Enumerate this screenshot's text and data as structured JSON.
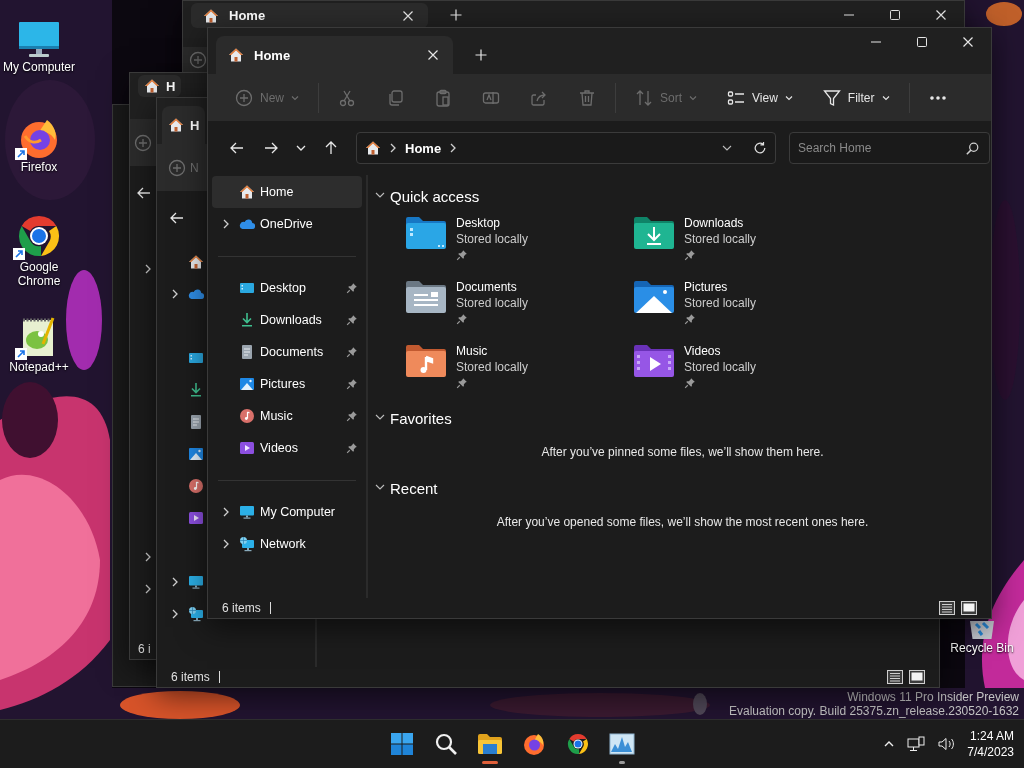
{
  "desktop": {
    "icons": [
      {
        "kind": "computer",
        "label": "My Computer",
        "shortcut": false
      },
      {
        "kind": "firefox",
        "label": "Firefox",
        "shortcut": true
      },
      {
        "kind": "chrome",
        "label": "Google Chrome",
        "shortcut": true
      },
      {
        "kind": "notepad",
        "label": "Notepad++",
        "shortcut": true
      }
    ],
    "recycle_bin": {
      "label": "Recycle Bin"
    }
  },
  "background_windows": [
    {
      "tab_title": "Home"
    },
    {
      "tab_title": "H",
      "status": "6 i"
    },
    {
      "tab_title": "H",
      "new_label": "N",
      "status": "6 items"
    }
  ],
  "window": {
    "tabs": [
      {
        "title": "Home",
        "selected": true
      }
    ],
    "toolbar": [
      {
        "kind": "new",
        "label": "New",
        "disabled": true,
        "menu": true
      },
      {
        "kind": "separator"
      },
      {
        "kind": "cut",
        "disabled": true
      },
      {
        "kind": "copy",
        "disabled": true
      },
      {
        "kind": "paste",
        "disabled": true
      },
      {
        "kind": "rename",
        "disabled": true
      },
      {
        "kind": "share",
        "disabled": true
      },
      {
        "kind": "delete",
        "disabled": true
      },
      {
        "kind": "separator"
      },
      {
        "kind": "sort",
        "label": "Sort",
        "disabled": true,
        "menu": true
      },
      {
        "kind": "view",
        "label": "View",
        "disabled": false,
        "menu": true
      },
      {
        "kind": "filter",
        "label": "Filter",
        "disabled": false,
        "menu": true
      },
      {
        "kind": "separator"
      },
      {
        "kind": "more",
        "disabled": false
      }
    ],
    "address": {
      "segments": [
        "Home"
      ]
    },
    "search": {
      "placeholder": "Search Home"
    },
    "sidebar": {
      "groups": [
        [
          {
            "kind": "home",
            "label": "Home",
            "selected": true
          },
          {
            "kind": "cloud",
            "label": "OneDrive",
            "selected": false,
            "expanded": false
          }
        ],
        [
          {
            "kind": "desktop",
            "label": "Desktop",
            "selected": false,
            "pinned": true
          },
          {
            "kind": "downloads",
            "label": "Downloads",
            "selected": false,
            "pinned": true
          },
          {
            "kind": "documents",
            "label": "Documents",
            "selected": false,
            "pinned": true
          },
          {
            "kind": "pictures",
            "label": "Pictures",
            "selected": false,
            "pinned": true
          },
          {
            "kind": "music",
            "label": "Music",
            "selected": false,
            "pinned": true
          },
          {
            "kind": "videos",
            "label": "Videos",
            "selected": false,
            "pinned": true
          }
        ],
        [
          {
            "kind": "computer",
            "label": "My Computer",
            "selected": false,
            "expanded": false
          },
          {
            "kind": "network",
            "label": "Network",
            "selected": false,
            "expanded": false
          }
        ]
      ]
    },
    "sections": [
      {
        "title": "Quick access",
        "expanded": true,
        "items": [
          {
            "kind": "desktop",
            "name": "Desktop",
            "detail": "Stored locally",
            "pinned": true
          },
          {
            "kind": "downloads",
            "name": "Downloads",
            "detail": "Stored locally",
            "pinned": true
          },
          {
            "kind": "documents",
            "name": "Documents",
            "detail": "Stored locally",
            "pinned": true
          },
          {
            "kind": "pictures",
            "name": "Pictures",
            "detail": "Stored locally",
            "pinned": true
          },
          {
            "kind": "music",
            "name": "Music",
            "detail": "Stored locally",
            "pinned": true
          },
          {
            "kind": "videos",
            "name": "Videos",
            "detail": "Stored locally",
            "pinned": true
          }
        ]
      },
      {
        "title": "Favorites",
        "expanded": true,
        "message": "After you’ve pinned some files, we’ll show them here."
      },
      {
        "title": "Recent",
        "expanded": true,
        "message": "After you’ve opened some files, we’ll show the most recent ones here."
      }
    ],
    "status_bar": {
      "count": "6 items"
    }
  },
  "build_info": [
    "Windows 11 Pro Insider Preview",
    "Evaluation copy. Build 25375.zn_release.230520-1632"
  ],
  "taskbar": {
    "apps": [
      {
        "kind": "start",
        "selected": false,
        "running": false
      },
      {
        "kind": "search",
        "selected": false,
        "running": false
      },
      {
        "kind": "explorer",
        "selected": true,
        "running": true
      },
      {
        "kind": "firefox",
        "selected": false,
        "running": false
      },
      {
        "kind": "chrome",
        "selected": false,
        "running": false
      },
      {
        "kind": "monitor",
        "selected": false,
        "running": true
      }
    ],
    "time": "1:24 AM",
    "date": "7/4/2023"
  }
}
